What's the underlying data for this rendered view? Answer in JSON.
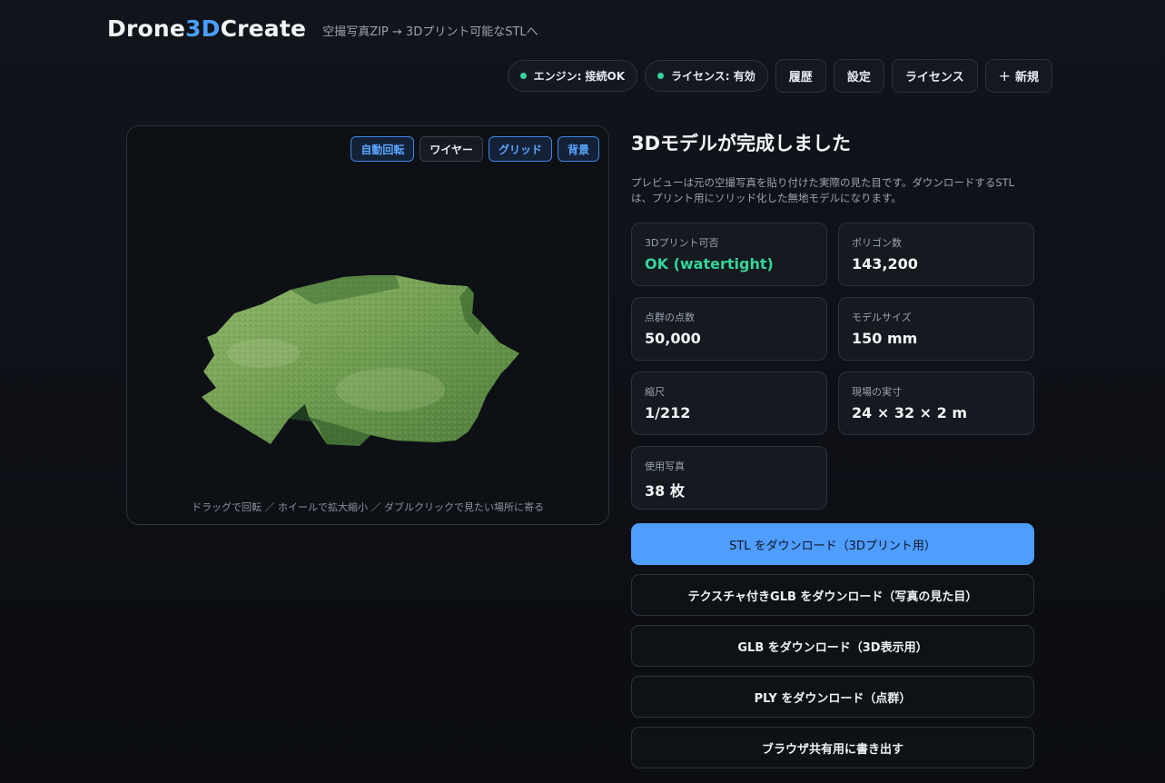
{
  "brand": {
    "prefix": "Drone",
    "accent": "3D",
    "suffix": "Create",
    "tagline": "空撮写真ZIP → 3Dプリント可能なSTLへ"
  },
  "status": [
    {
      "label": "エンジン: 接続OK",
      "color": "#35d49a"
    },
    {
      "label": "ライセンス: 有効",
      "color": "#35d49a"
    }
  ],
  "nav": {
    "history": "履歴",
    "settings": "設定",
    "license": "ライセンス",
    "new": "新規",
    "new_icon": "plus-icon"
  },
  "viewer": {
    "tools": [
      {
        "label": "自動回転",
        "active": true
      },
      {
        "label": "ワイヤー",
        "active": false
      },
      {
        "label": "グリッド",
        "active": true
      },
      {
        "label": "背景",
        "active": true
      }
    ],
    "hint": "ドラッグで回転 ／ ホイールで拡大縮小 ／ ダブルクリックで見たい場所に寄る"
  },
  "result": {
    "title": "3Dモデルが完成しました",
    "description": "プレビューは元の空撮写真を貼り付けた実際の見た目です。ダウンロードするSTLは、プリント用にソリッド化した無地モデルになります。",
    "stats": [
      {
        "label": "3Dプリント可否",
        "value": "OK (watertight)",
        "ok": true
      },
      {
        "label": "ポリゴン数",
        "value": "143,200"
      },
      {
        "label": "点群の点数",
        "value": "50,000"
      },
      {
        "label": "モデルサイズ",
        "value": "150 mm"
      },
      {
        "label": "縮尺",
        "value": "1/212"
      },
      {
        "label": "現場の実寸",
        "value": "24 × 32 × 2 m"
      },
      {
        "label": "使用写真",
        "value": "38 枚"
      }
    ]
  },
  "downloads": [
    {
      "label": "STL をダウンロード（3Dプリント用）",
      "primary": true
    },
    {
      "label": "テクスチャ付きGLB をダウンロード（写真の見た目）"
    },
    {
      "label": "GLB をダウンロード（3D表示用）"
    },
    {
      "label": "PLY をダウンロード（点群）"
    },
    {
      "label": "ブラウザ共有用に書き出す"
    }
  ],
  "colors": {
    "accent": "#4a9eff",
    "ok": "#35d49a",
    "background": "#0b0d12"
  }
}
